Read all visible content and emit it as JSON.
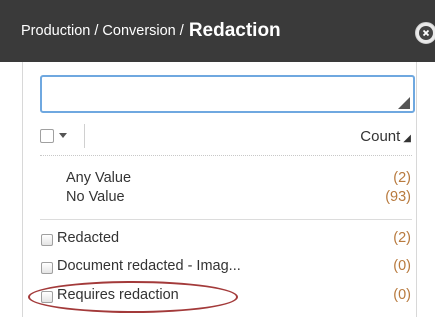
{
  "header": {
    "path": "Production / Conversion / ",
    "title": "Redaction"
  },
  "facet": {
    "search_value": "",
    "count_label": "Count",
    "count_sort_icon": "sort-desc-triangle",
    "special_values": [
      {
        "label": "Any Value",
        "count": "(2)"
      },
      {
        "label": "No Value",
        "count": "(93)"
      }
    ],
    "items": [
      {
        "label": "Redacted",
        "count": "(2)"
      },
      {
        "label": "Document redacted - Imag...",
        "count": "(0)"
      },
      {
        "label": "Requires redaction",
        "count": "(0)",
        "highlighted": true
      }
    ]
  },
  "colors": {
    "header_bg": "#3a3a3a",
    "count_text": "#b87a3e",
    "focus_border": "#6fa8e0",
    "highlight_oval": "#a33a3a"
  }
}
